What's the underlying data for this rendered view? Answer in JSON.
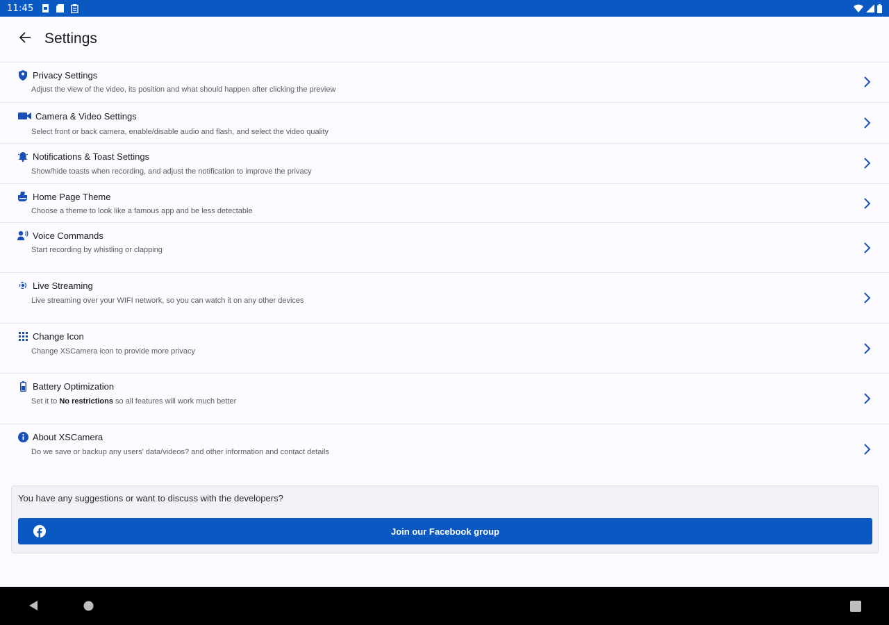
{
  "status_bar": {
    "time": "11:45",
    "left_icons": [
      "sim-card-icon",
      "sd-card-icon",
      "clipboard-icon"
    ],
    "right_icons": [
      "wifi-icon",
      "signal-icon",
      "battery-icon"
    ]
  },
  "app_bar": {
    "back_icon": "arrow-left-icon",
    "title": "Settings"
  },
  "settings": [
    {
      "icon": "shield-icon",
      "title": "Privacy Settings",
      "description": "Adjust the view of the video, its position and what should happen after clicking the preview"
    },
    {
      "icon": "video-camera-icon",
      "title": "Camera & Video Settings",
      "description": "Select front or back camera, enable/disable audio and flash, and select the video quality"
    },
    {
      "icon": "notification-bell-icon",
      "title": "Notifications & Toast Settings",
      "description": "Show/hide toasts when recording, and adjust the notification to improve the privacy"
    },
    {
      "icon": "theme-palette-icon",
      "title": "Home Page Theme",
      "description": "Choose a theme to look like a famous app and be less detectable"
    },
    {
      "icon": "voice-command-icon",
      "title": "Voice Commands",
      "description": "Start recording by whistling or clapping"
    },
    {
      "icon": "live-stream-icon",
      "title": "Live Streaming",
      "description": "Live streaming over your WIFI network, so you can watch it on any other devices"
    },
    {
      "icon": "app-grid-icon",
      "title": "Change Icon",
      "description": "Change XSCamera icon to provide more privacy"
    },
    {
      "icon": "battery-icon",
      "title": "Battery Optimization",
      "description_prefix": "Set it to ",
      "description_bold": "No restrictions",
      "description_suffix": " so all features will work much better"
    },
    {
      "icon": "info-icon",
      "title": "About XSCamera",
      "description": "Do we save or backup any users' data/videos? and other information and contact details"
    }
  ],
  "suggestion_card": {
    "text": "You have any suggestions or want to discuss with the developers?",
    "button_label": "Join our Facebook group",
    "button_icon": "facebook-icon"
  },
  "nav_bar": {
    "icons": [
      "nav-back-icon",
      "nav-home-icon",
      "nav-recents-icon"
    ]
  },
  "colors": {
    "primary": "#0a58c2",
    "background": "#fbfaff",
    "icon": "#1a4fb8"
  }
}
